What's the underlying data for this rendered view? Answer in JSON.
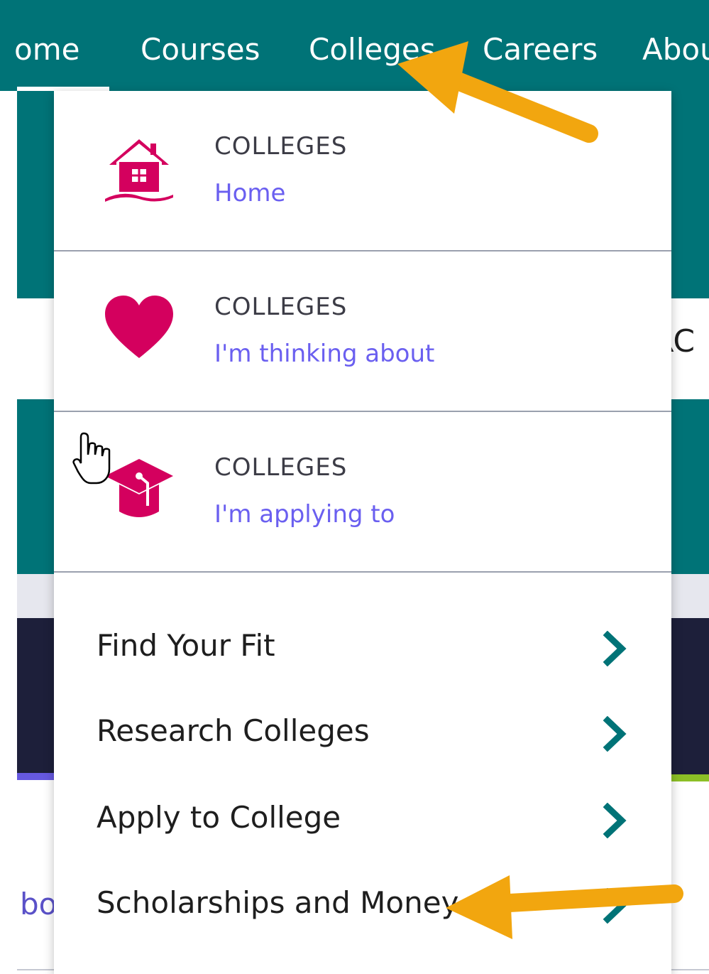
{
  "nav": {
    "items": [
      "ome",
      "Courses",
      "Colleges",
      "Careers",
      "Abou"
    ]
  },
  "background": {
    "fragment_right": "RC",
    "fragment_left_link": "bo"
  },
  "menu": {
    "cards": [
      {
        "kicker": "COLLEGES",
        "title": "Home",
        "icon": "house-icon"
      },
      {
        "kicker": "COLLEGES",
        "title": "I'm thinking about",
        "icon": "heart-icon"
      },
      {
        "kicker": "COLLEGES",
        "title": "I'm applying to",
        "icon": "graduation-cap-icon"
      }
    ],
    "links": [
      {
        "label": "Find Your Fit",
        "icon": "chevron-right-icon"
      },
      {
        "label": "Research Colleges",
        "icon": "chevron-right-icon"
      },
      {
        "label": "Apply to College",
        "icon": "chevron-right-icon"
      },
      {
        "label": "Scholarships and Money",
        "icon": "chevron-right-icon"
      }
    ]
  },
  "colors": {
    "teal": "#007377",
    "magenta": "#d4005e",
    "link_purple": "#6a5ff0",
    "arrow_orange": "#f2a60f",
    "dark_navy": "#1d1f3a"
  }
}
